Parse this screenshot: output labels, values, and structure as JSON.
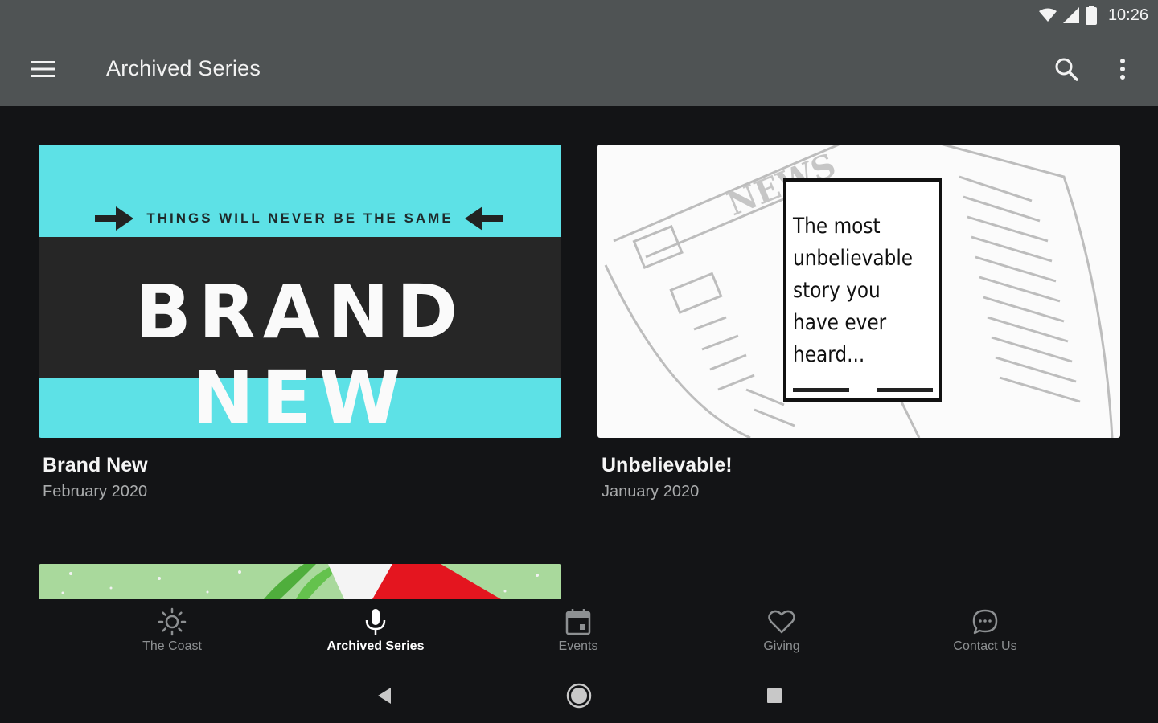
{
  "status_bar": {
    "time": "10:26",
    "icons": [
      "wifi-icon",
      "signal-icon",
      "battery-icon"
    ]
  },
  "toolbar": {
    "title": "Archived Series",
    "icons": [
      "menu-icon",
      "search-icon",
      "more-vert-icon"
    ]
  },
  "series": [
    {
      "title": "Brand New",
      "date": "February 2020",
      "art": {
        "tagline": "THINGS WILL NEVER BE THE SAME",
        "headline": "BRAND NEW"
      }
    },
    {
      "title": "Unbelievable!",
      "date": "January 2020",
      "art": {
        "watermark": "NEWS",
        "lines": [
          "The most",
          "unbelievable",
          "story you",
          "have ever",
          "heard..."
        ]
      }
    }
  ],
  "bottom_nav": {
    "items": [
      {
        "label": "The Coast",
        "icon": "sun-icon",
        "active": false
      },
      {
        "label": "Archived Series",
        "icon": "microphone-icon",
        "active": true
      },
      {
        "label": "Events",
        "icon": "calendar-icon",
        "active": false
      },
      {
        "label": "Giving",
        "icon": "heart-icon",
        "active": false
      },
      {
        "label": "Contact Us",
        "icon": "chat-bubble-icon",
        "active": false
      }
    ]
  },
  "colors": {
    "toolbar_bg": "#4f5354",
    "page_bg": "#131416",
    "brand_new_cyan": "#5de1e6",
    "brand_new_band": "#262626"
  }
}
